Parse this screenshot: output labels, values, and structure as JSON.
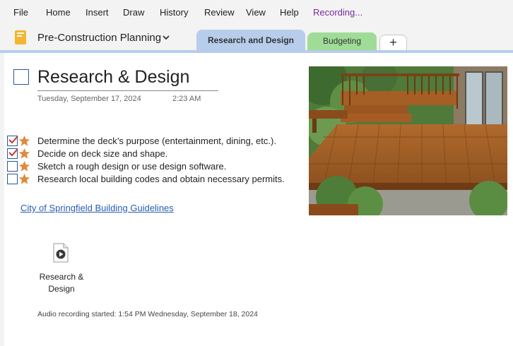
{
  "menu": {
    "file": "File",
    "home": "Home",
    "insert": "Insert",
    "draw": "Draw",
    "history": "History",
    "review": "Review",
    "view": "View",
    "help": "Help",
    "recording": "Recording..."
  },
  "notebook": {
    "title": "Pre-Construction Planning",
    "icon": "notebook-icon"
  },
  "tabs": [
    {
      "label": "Research and Design",
      "color": "#b7cdeb"
    },
    {
      "label": "Budgeting",
      "color": "#9fdc98"
    },
    {
      "label": "+"
    }
  ],
  "page": {
    "title": "Research & Design",
    "date": "Tuesday, September 17, 2024",
    "time": "2:23 AM"
  },
  "todos": [
    {
      "text": "Determine the deck’s purpose (entertainment, dining, etc.).",
      "checked": true
    },
    {
      "text": "Decide on deck size and shape.",
      "checked": true
    },
    {
      "text": "Sketch a rough design or use design software.",
      "checked": false
    },
    {
      "text": "Research local building codes and obtain necessary permits.",
      "checked": false
    }
  ],
  "link": {
    "text": "City of Springfield Building Guidelines"
  },
  "attachment": {
    "label_line1": "Research &",
    "label_line2": "Design",
    "icon": "audio-file-icon"
  },
  "audio_note": "Audio recording started: 1:54 PM Wednesday, September 18, 2024",
  "colors": {
    "accent": "#2b5797",
    "star": "#e08a3c",
    "check": "#c0392b",
    "recording": "#7a2a9a"
  }
}
